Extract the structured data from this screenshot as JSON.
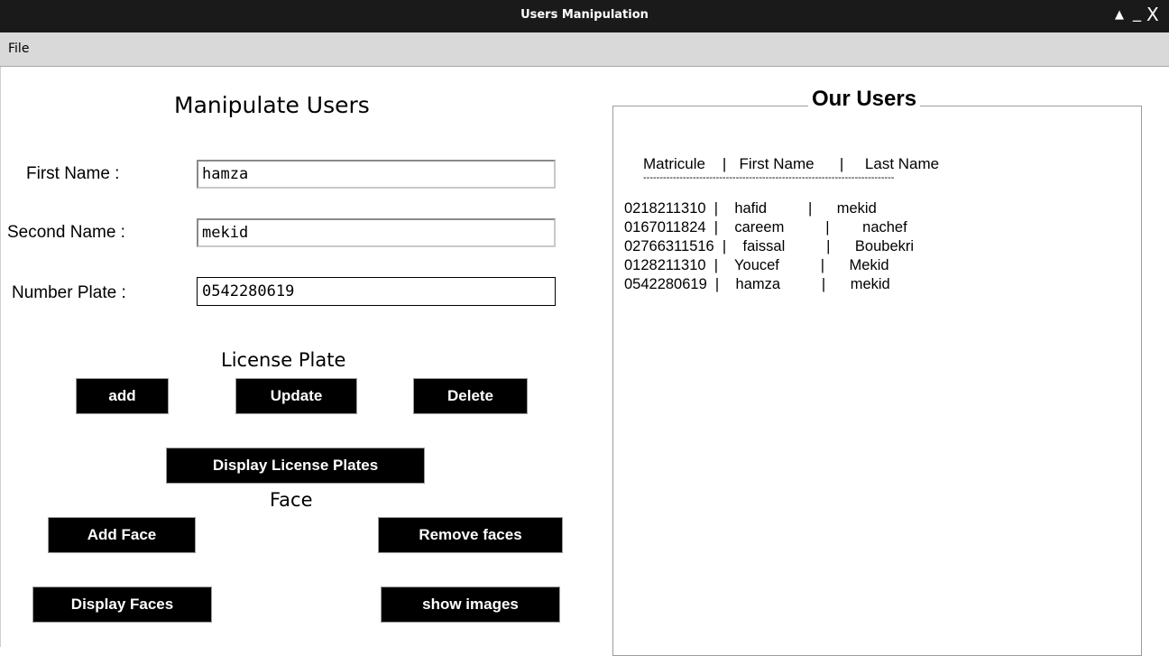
{
  "window": {
    "title": "Users Manipulation",
    "controls": {
      "up": "▲",
      "minimize": "_",
      "close": "X"
    }
  },
  "menu": {
    "file": "File"
  },
  "form": {
    "heading": "Manipulate Users",
    "first_name_label": "First Name :",
    "first_name_value": "hamza",
    "second_name_label": "Second  Name :",
    "second_name_value": "mekid",
    "plate_label": "Number Plate :",
    "plate_value": "0542280619"
  },
  "license_plate": {
    "heading": "License Plate",
    "add": "add",
    "update": "Update",
    "delete": "Delete",
    "display": "Display License Plates"
  },
  "face": {
    "heading": "Face",
    "add": "Add  Face",
    "remove": "Remove faces",
    "display": "Display Faces",
    "show_images": "show  images"
  },
  "users": {
    "title": "Our Users",
    "header": "Matricule    |   First Name      |     Last Name",
    "separator": "----------------------------------------------------------------------------",
    "rows": [
      "0218211310  |    hafid          |      mekid",
      "0167011824  |    careem          |        nachef",
      "02766311516  |    faissal          |      Boubekri",
      "0128211310  |    Youcef          |      Mekid",
      "0542280619  |    hamza          |      mekid"
    ]
  }
}
